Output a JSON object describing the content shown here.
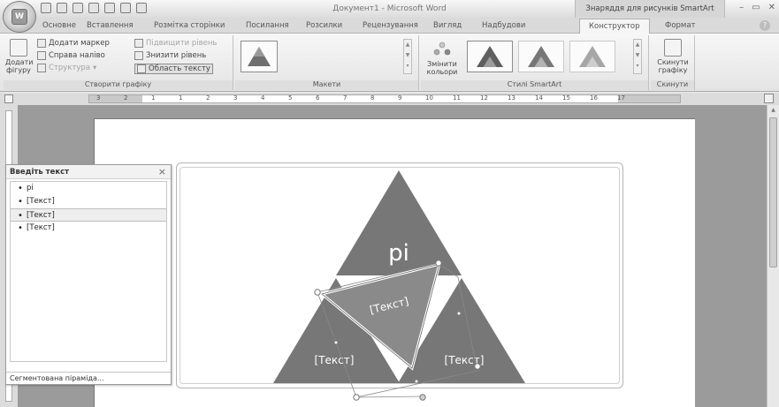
{
  "titlebar": {
    "doc_title": "Документ1 - Microsoft Word",
    "context_header": "Знаряддя для рисунків SmartArt",
    "office_logo": "W"
  },
  "tabs": [
    "Основне",
    "Вставлення",
    "Розмітка сторінки",
    "Посилання",
    "Розсилки",
    "Рецензування",
    "Вигляд",
    "Надбудови",
    "Конструктор",
    "Формат"
  ],
  "ribbon": {
    "create_group": {
      "label": "Створити графіку",
      "add_shape": "Додати фігуру",
      "add_bullet": "Додати маркер",
      "right_to_left": "Справа наліво",
      "layout": "Структура",
      "promote": "Підвищити рівень",
      "demote": "Знизити рівень",
      "text_pane": "Область тексту"
    },
    "layouts_group": {
      "label": "Макети"
    },
    "styles_group": {
      "label": "Стилі SmartArt",
      "change_colors": "Змінити кольори"
    },
    "reset_group": {
      "label": "Скинути",
      "reset_graphic": "Скинути графіку"
    }
  },
  "ruler": {
    "numbers": [
      "3",
      "2",
      "1",
      "1",
      "2",
      "3",
      "4",
      "5",
      "6",
      "7",
      "8",
      "9",
      "10",
      "11",
      "12",
      "13",
      "14",
      "15",
      "16",
      "17"
    ]
  },
  "text_pane": {
    "title": "Введіть текст",
    "items": [
      "pi",
      "[Текст]",
      "[Текст]",
      "[Текст]"
    ],
    "selected_index": 2,
    "footer": "Сегментована піраміда..."
  },
  "smartart": {
    "top_label": "pi",
    "center_label": "[Текст]",
    "left_label": "[Текст]",
    "right_label": "[Текст]",
    "fill_color": "#777777",
    "selected_shape_fill": "#8a8a8a"
  }
}
